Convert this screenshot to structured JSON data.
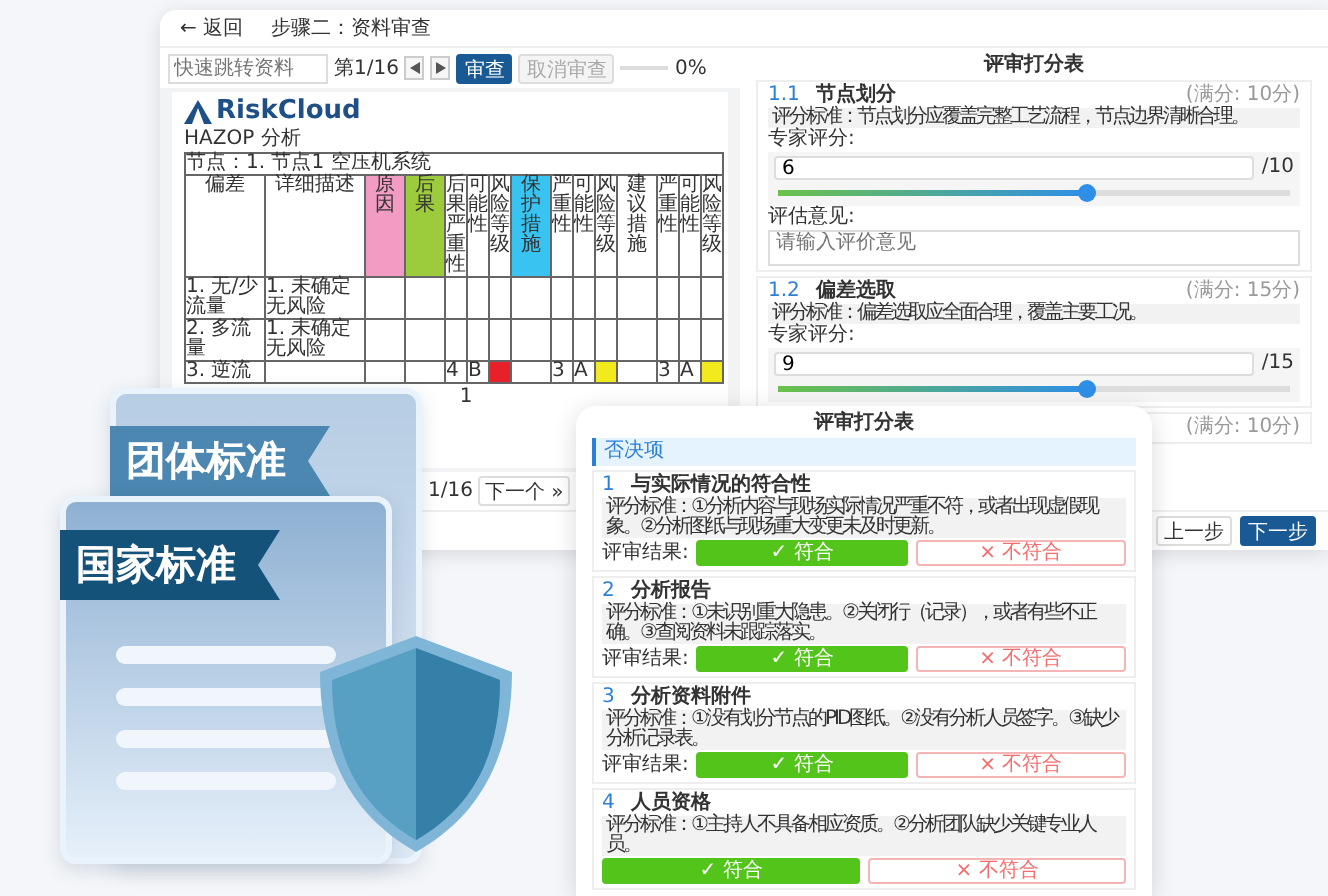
{
  "main_window": {
    "back_link": "← 返回",
    "step_title": "步骤二：资料审查",
    "toolbar": {
      "doc_select": {
        "placeholder": "快速跳转资料"
      },
      "page_indicator": "第1/16",
      "review_button": "审查",
      "cancel_button": "取消审查",
      "progress": {
        "level": 0,
        "reading": "0%"
      }
    },
    "document": {
      "logo": "RiskCloud",
      "heading": "HAZOP 分析",
      "node_line": "节点：1. 节点1 空压机系统",
      "columns": [
        {
          "label": "偏差"
        },
        {
          "label": "详细描述"
        },
        {
          "label": "原因",
          "color": "#f29cc4"
        },
        {
          "label": "后果",
          "color": "#9ccb3c"
        },
        {
          "label": "后果严重性"
        },
        {
          "label": "可能性"
        },
        {
          "label": "风险等级"
        },
        {
          "label": "保护措施",
          "color": "#38c3f0"
        },
        {
          "label": "严重性"
        },
        {
          "label": "可能性"
        },
        {
          "label": "风险等级"
        },
        {
          "label": "建议措施"
        },
        {
          "label": "严重性"
        },
        {
          "label": "可能性"
        },
        {
          "label": "风险等级"
        }
      ],
      "rows": [
        {
          "cells": [
            {
              "text": "1. 无/少流量"
            },
            {
              "text": "1. 未确定无风险"
            },
            {},
            {},
            {},
            {},
            {},
            {},
            {},
            {},
            {},
            {},
            {},
            {},
            {}
          ]
        },
        {
          "cells": [
            {
              "text": "2. 多流量"
            },
            {
              "text": "1. 未确定无风险"
            },
            {},
            {},
            {},
            {},
            {},
            {},
            {},
            {},
            {},
            {},
            {},
            {},
            {}
          ]
        },
        {
          "cells": [
            {
              "text": "3. 逆流"
            },
            {},
            {},
            {},
            {
              "text": "4"
            },
            {
              "text": "B"
            },
            {
              "color": "#e8202a"
            },
            {},
            {
              "text": "3"
            },
            {
              "text": "A"
            },
            {
              "color": "#f2ea1c"
            },
            {},
            {
              "text": "3"
            },
            {
              "text": "A"
            },
            {
              "color": "#f2ea1c"
            }
          ]
        }
      ],
      "page_number": "1",
      "pager": {
        "count": "1/16",
        "next_button": "下一个 »"
      }
    },
    "review": {
      "title": "评审打分表",
      "sections": [
        {
          "number": "1.1",
          "title": "节点划分",
          "max": "(满分: 10分)",
          "criteria": "评分标准：节点划分应覆盖完整工艺流程，节点边界清晰合理。",
          "score_label": "专家评分:",
          "score": "6",
          "unit": "/10",
          "level": 0.6,
          "comment_label": "评估意见:",
          "comment_placeholder": "请输入评价意见"
        },
        {
          "number": "1.2",
          "title": "偏差选取",
          "max": "(满分: 15分)",
          "criteria": "评分标准：偏差选取应全面合理，覆盖主要工况。",
          "score_label": "专家评分:",
          "score": "9",
          "unit": "/15",
          "level": 0.6
        },
        {
          "max": "(满分: 10分)"
        }
      ],
      "prev_button": "上一步",
      "next_button": "下一步"
    }
  },
  "front_window": {
    "title": "评审打分表",
    "group": "否决项",
    "items": [
      {
        "number": "1",
        "title": "与实际情况的符合性",
        "criteria": "评分标准：①分析内容与现场实际情况严重不符，或者出现虚假现象。②分析图纸与现场重大变更未及时更新。",
        "result_label": "评审结果:",
        "options": [
          {
            "label": "✓ 符合",
            "selected": true
          },
          {
            "label": "× 不符合",
            "selected": false
          }
        ]
      },
      {
        "number": "2",
        "title": "分析报告",
        "criteria": "评分标准：①未识别重大隐患。②关闭行（记录），或者有些不正确。③查阅资料未跟踪落实。",
        "result_label": "评审结果:",
        "options": [
          {
            "label": "✓ 符合",
            "selected": true
          },
          {
            "label": "× 不符合",
            "selected": false
          }
        ]
      },
      {
        "number": "3",
        "title": "分析资料附件",
        "criteria": "评分标准：①没有划分节点的PID图纸。②没有分析人员签字。③缺少分析记录表。",
        "result_label": "评审结果:",
        "options": [
          {
            "label": "✓ 符合",
            "selected": true
          },
          {
            "label": "× 不符合",
            "selected": false
          }
        ]
      },
      {
        "number": "4",
        "title": "人员资格",
        "criteria": "评分标准：①主持人不具备相应资质。②分析团队缺少关键专业人员。",
        "options": [
          {
            "label": "✓ 符合",
            "selected": true
          },
          {
            "label": "× 不符合",
            "selected": false
          }
        ]
      }
    ]
  },
  "illustration": {
    "back_ribbon": "团体标准",
    "front_ribbon": "国家标准"
  }
}
